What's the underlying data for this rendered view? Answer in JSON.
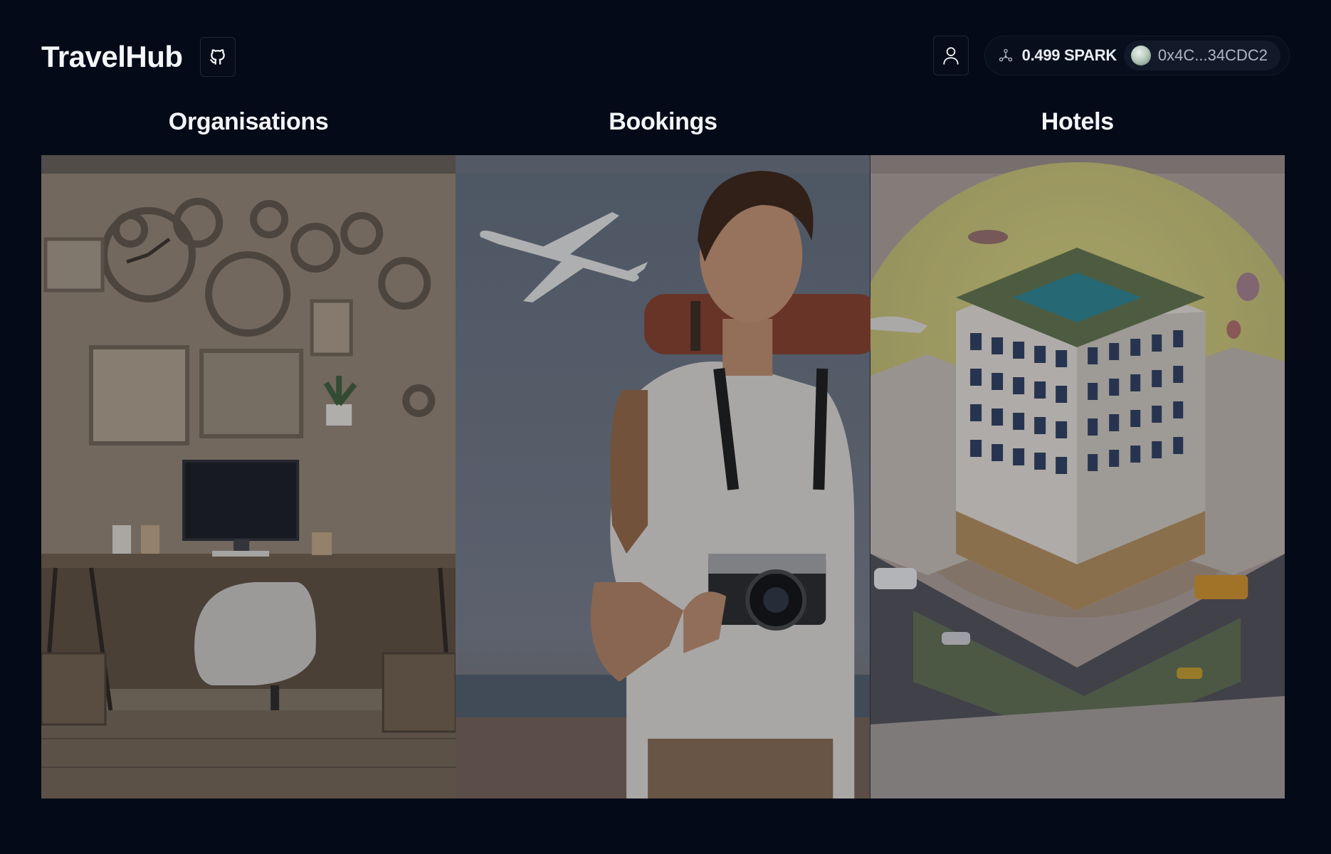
{
  "header": {
    "app_title": "TravelHub",
    "github_icon": "github-icon",
    "account_icon": "user-icon",
    "wallet": {
      "network_icon": "network-icon",
      "balance": "0.499 SPARK",
      "address": "0x4C...34CDC2"
    }
  },
  "sections": [
    {
      "title": "Organisations",
      "image": "office-desk-illustration"
    },
    {
      "title": "Bookings",
      "image": "traveler-with-camera-illustration"
    },
    {
      "title": "Hotels",
      "image": "isometric-hotel-illustration"
    }
  ],
  "colors": {
    "background": "#040a18",
    "text": "#ffffff",
    "muted": "#aeb5c2"
  }
}
